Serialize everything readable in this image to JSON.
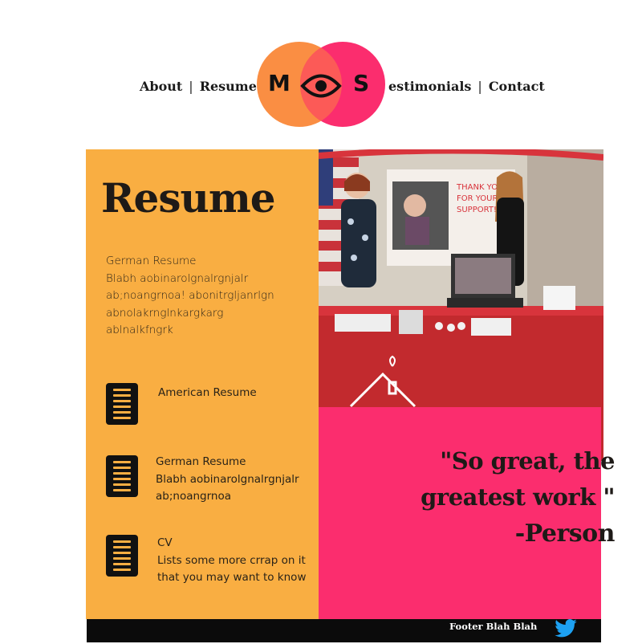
{
  "nav": {
    "left_items": [
      {
        "label": "About"
      },
      {
        "label": "Resume"
      }
    ],
    "right_items": [
      {
        "label": "estimonials"
      },
      {
        "label": "Contact"
      }
    ],
    "separator": "|"
  },
  "logo": {
    "letter_left": "M",
    "letter_right": "S",
    "icon": "eye-icon",
    "colors": {
      "left_circle": "#fa8e43",
      "right_circle": "#fb2d6e",
      "overlap": "#fc5a57"
    }
  },
  "resume": {
    "title": "Resume",
    "intro_lines": [
      "German Resume",
      "Blabh aobinarolgnalrgnjalr",
      "ab;noangrnoa! abonitrgljanrlgn",
      "abnolakrnglnkargkarg",
      "ablnalkfngrk"
    ],
    "items": [
      {
        "lines": [
          "American Resume"
        ],
        "icon": "document-icon"
      },
      {
        "lines": [
          "German Resume",
          "Blabh aobinarolgnalrgnjalr",
          "ab;noangrnoa"
        ],
        "icon": "document-icon"
      },
      {
        "lines": [
          "CV",
          "Lists some more crrap on it",
          "that you may want to know"
        ],
        "icon": "document-icon"
      }
    ]
  },
  "quote": {
    "lines": [
      "\"So great, the",
      "greatest work \""
    ],
    "author": "-Person"
  },
  "footer": {
    "text": "Footer Blah Blah",
    "icon": "twitter-icon"
  },
  "colors": {
    "orange": "#f9ae42",
    "pink": "#fb2d6e",
    "dark": "#1e1a17",
    "footer": "#0b0b0b",
    "twitter": "#1da1f2"
  }
}
